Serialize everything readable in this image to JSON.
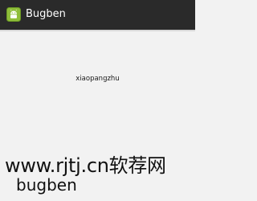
{
  "app": {
    "title": "Bugben",
    "icon": "android-app-icon"
  },
  "main": {
    "text": "xiaopangzhu"
  },
  "watermark": {
    "url_text": "www.rjtj.cn软荐网",
    "name_text": "bugben"
  },
  "colors": {
    "action_bar": "#2a2a2a",
    "background": "#f2f2f2",
    "icon_green": "#8fbe3a"
  }
}
